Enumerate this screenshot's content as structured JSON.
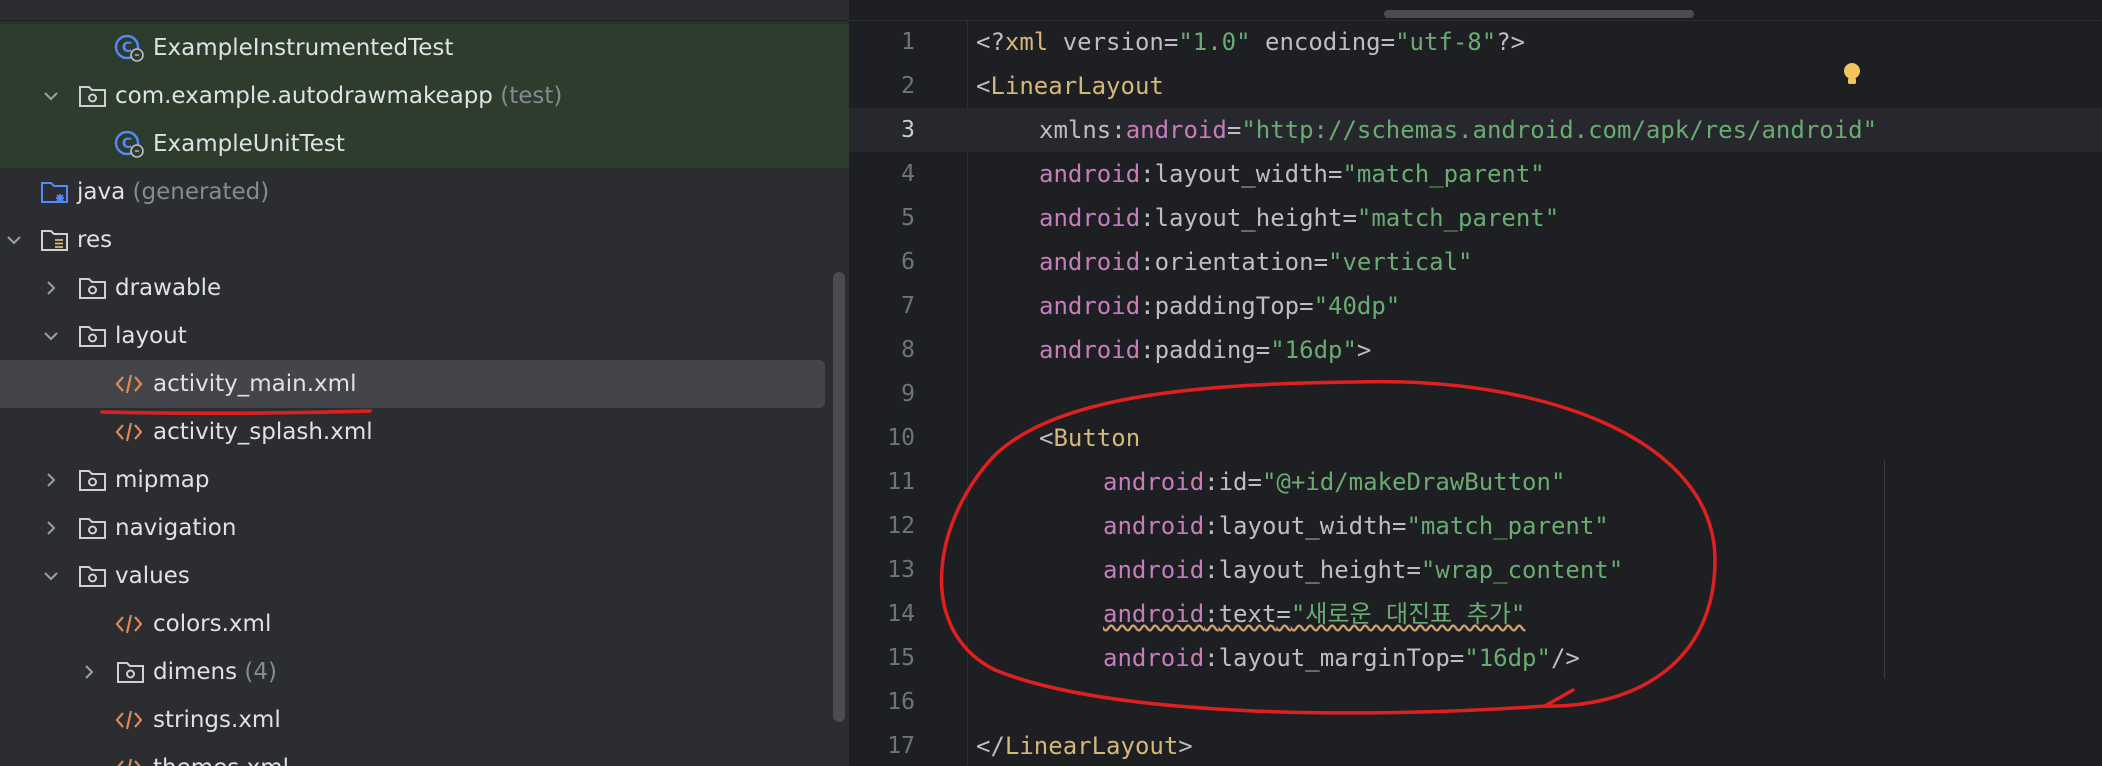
{
  "tree": {
    "items": [
      {
        "label": "ExampleInstrumentedTest",
        "suffix": "",
        "icon": "test-class-icon"
      },
      {
        "label": "com.example.autodrawmakeapp",
        "suffix": "(test)",
        "icon": "package-folder-icon"
      },
      {
        "label": "ExampleUnitTest",
        "suffix": "",
        "icon": "test-class-icon"
      },
      {
        "label": "java",
        "suffix": "(generated)",
        "icon": "generated-source-folder-icon"
      },
      {
        "label": "res",
        "suffix": "",
        "icon": "resource-folder-icon"
      },
      {
        "label": "drawable",
        "suffix": "",
        "icon": "folder-icon"
      },
      {
        "label": "layout",
        "suffix": "",
        "icon": "folder-icon"
      },
      {
        "label": "activity_main.xml",
        "suffix": "",
        "icon": "xml-file-icon"
      },
      {
        "label": "activity_splash.xml",
        "suffix": "",
        "icon": "xml-file-icon"
      },
      {
        "label": "mipmap",
        "suffix": "",
        "icon": "folder-icon"
      },
      {
        "label": "navigation",
        "suffix": "",
        "icon": "folder-icon"
      },
      {
        "label": "values",
        "suffix": "",
        "icon": "folder-icon"
      },
      {
        "label": "colors.xml",
        "suffix": "",
        "icon": "xml-file-icon"
      },
      {
        "label": "dimens",
        "suffix": "(4)",
        "icon": "folder-icon"
      },
      {
        "label": "strings.xml",
        "suffix": "",
        "icon": "xml-file-icon"
      },
      {
        "label": "themes.xml",
        "suffix": "",
        "icon": "xml-file-icon"
      }
    ],
    "selected": "activity_main.xml"
  },
  "editor": {
    "current_line": 3,
    "lines": [
      {
        "n": "1",
        "t": [
          [
            "pl",
            "<?"
          ],
          [
            "tg",
            "xml "
          ],
          [
            "at",
            "version"
          ],
          [
            "pl",
            "="
          ],
          [
            "sv",
            "\"1.0\""
          ],
          [
            "at",
            " encoding"
          ],
          [
            "pl",
            "="
          ],
          [
            "sv",
            "\"utf-8\""
          ],
          [
            "pl",
            "?>"
          ]
        ]
      },
      {
        "n": "2",
        "t": [
          [
            "pl",
            "<"
          ],
          [
            "tg",
            "LinearLayout"
          ]
        ]
      },
      {
        "n": "3",
        "t": [
          [
            "at",
            "xmlns"
          ],
          [
            "pl",
            ":"
          ],
          [
            "an",
            "android"
          ],
          [
            "pl",
            "="
          ],
          [
            "sv",
            "\"http://schemas.android.com/apk/res/android\""
          ]
        ]
      },
      {
        "n": "4",
        "t": [
          [
            "an",
            "android"
          ],
          [
            "pl",
            ":"
          ],
          [
            "at",
            "layout_width"
          ],
          [
            "pl",
            "="
          ],
          [
            "sv",
            "\"match_parent\""
          ]
        ]
      },
      {
        "n": "5",
        "t": [
          [
            "an",
            "android"
          ],
          [
            "pl",
            ":"
          ],
          [
            "at",
            "layout_height"
          ],
          [
            "pl",
            "="
          ],
          [
            "sv",
            "\"match_parent\""
          ]
        ]
      },
      {
        "n": "6",
        "t": [
          [
            "an",
            "android"
          ],
          [
            "pl",
            ":"
          ],
          [
            "at",
            "orientation"
          ],
          [
            "pl",
            "="
          ],
          [
            "sv",
            "\"vertical\""
          ]
        ]
      },
      {
        "n": "7",
        "t": [
          [
            "an",
            "android"
          ],
          [
            "pl",
            ":"
          ],
          [
            "at",
            "paddingTop"
          ],
          [
            "pl",
            "="
          ],
          [
            "sv",
            "\"40dp\""
          ]
        ]
      },
      {
        "n": "8",
        "t": [
          [
            "an",
            "android"
          ],
          [
            "pl",
            ":"
          ],
          [
            "at",
            "padding"
          ],
          [
            "pl",
            "="
          ],
          [
            "sv",
            "\"16dp\""
          ],
          [
            "pl",
            ">"
          ]
        ]
      },
      {
        "n": "9",
        "t": []
      },
      {
        "n": "10",
        "t": [
          [
            "pl",
            "<"
          ],
          [
            "tg",
            "Button"
          ]
        ]
      },
      {
        "n": "11",
        "t": [
          [
            "an",
            "android"
          ],
          [
            "pl",
            ":"
          ],
          [
            "at",
            "id"
          ],
          [
            "pl",
            "="
          ],
          [
            "sv",
            "\"@+id/makeDrawButton\""
          ]
        ]
      },
      {
        "n": "12",
        "t": [
          [
            "an",
            "android"
          ],
          [
            "pl",
            ":"
          ],
          [
            "at",
            "layout_width"
          ],
          [
            "pl",
            "="
          ],
          [
            "sv",
            "\"match_parent\""
          ]
        ]
      },
      {
        "n": "13",
        "t": [
          [
            "an",
            "android"
          ],
          [
            "pl",
            ":"
          ],
          [
            "at",
            "layout_height"
          ],
          [
            "pl",
            "="
          ],
          [
            "sv",
            "\"wrap_content\""
          ]
        ]
      },
      {
        "n": "14",
        "t": [
          [
            "an",
            "android"
          ],
          [
            "pl",
            ":"
          ],
          [
            "at",
            "text"
          ],
          [
            "pl",
            "="
          ],
          [
            "sv",
            "\"새로운 대진표 추가\""
          ]
        ]
      },
      {
        "n": "15",
        "t": [
          [
            "an",
            "android"
          ],
          [
            "pl",
            ":"
          ],
          [
            "at",
            "layout_marginTop"
          ],
          [
            "pl",
            "="
          ],
          [
            "sv",
            "\"16dp\""
          ],
          [
            "pl",
            "/>"
          ]
        ]
      },
      {
        "n": "16",
        "t": []
      },
      {
        "n": "17",
        "t": [
          [
            "pl",
            "</"
          ],
          [
            "tg",
            "LinearLayout"
          ],
          [
            "pl",
            ">"
          ]
        ]
      }
    ]
  },
  "colors": {
    "tag": "#d5b778",
    "namespace": "#c77dbb",
    "string": "#6aab73",
    "annotation": "#e02020"
  }
}
